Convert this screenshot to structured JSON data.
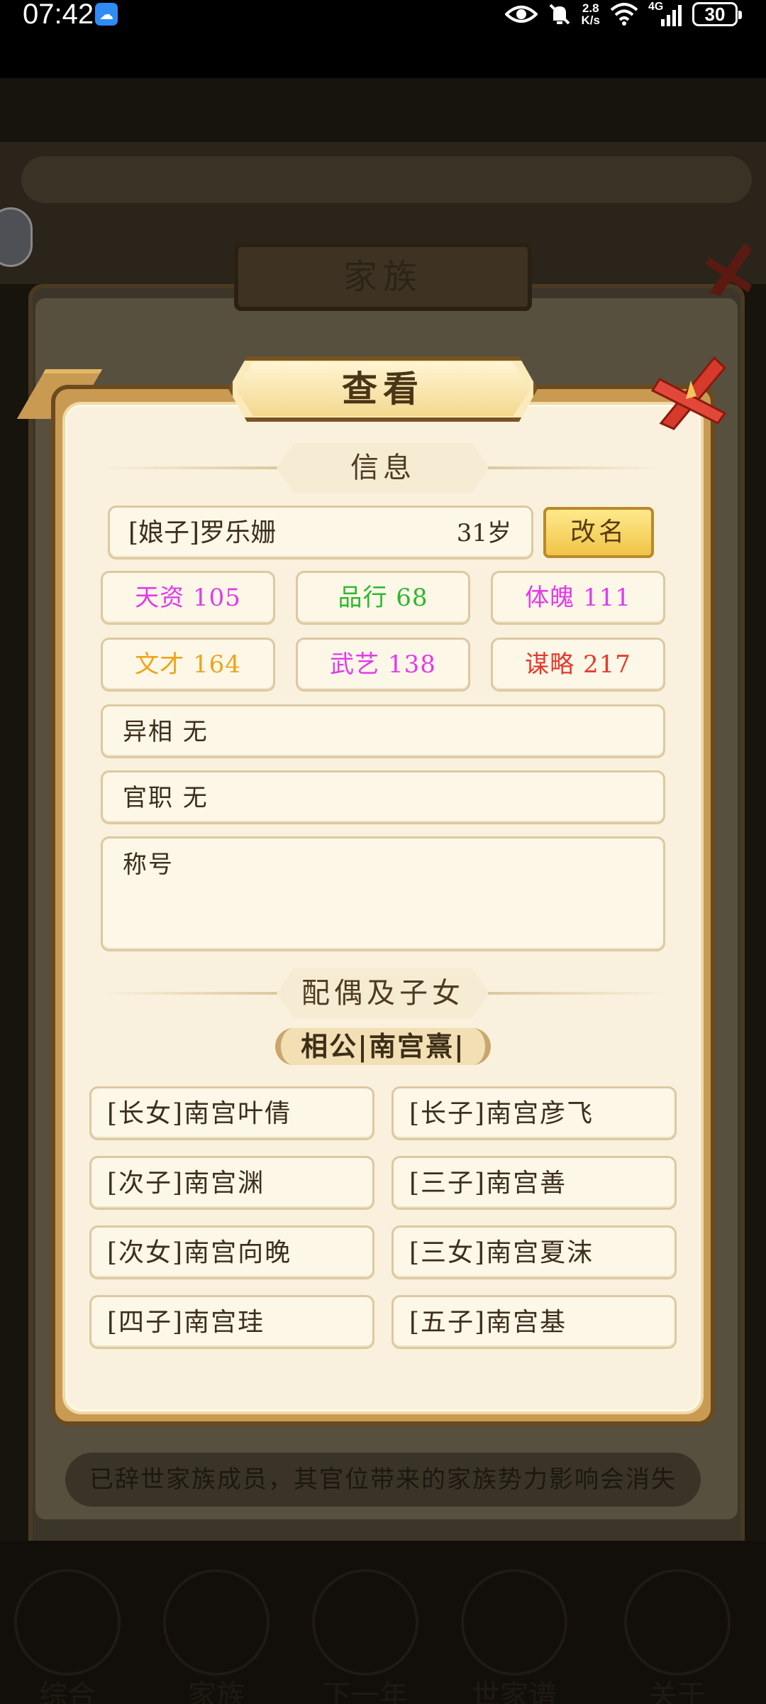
{
  "status_bar": {
    "time": "07:42",
    "net_speed_value": "2.8",
    "net_speed_unit": "K/s",
    "network_type": "4G",
    "battery": "30"
  },
  "background": {
    "panel_title": "家族",
    "footer_note": "已辞世家族成员，其官位带来的家族势力影响会消失",
    "bottom_nav": [
      "综合",
      "家族",
      "下一年",
      "世家谱",
      "关于"
    ]
  },
  "modal": {
    "title": "查看",
    "info_section_title": "信息",
    "member_name": "[娘子]罗乐姗",
    "member_age": "31岁",
    "rename_label": "改名",
    "stats": [
      {
        "label": "天资 105",
        "color": "#e23be8"
      },
      {
        "label": "品行 68",
        "color": "#2cb82c"
      },
      {
        "label": "体魄 111",
        "color": "#e23be8"
      },
      {
        "label": "文才 164",
        "color": "#f0a318"
      },
      {
        "label": "武艺 138",
        "color": "#e23be8"
      },
      {
        "label": "谋略 217",
        "color": "#e8382a"
      }
    ],
    "appearance": "异相  无",
    "official_post": "官职  无",
    "titles_label": "称号",
    "family_section_title": "配偶及子女",
    "spouse": "相公|南宫熹|",
    "children": [
      "[长女]南宫叶倩",
      "[长子]南宫彦飞",
      "[次子]南宫渊",
      "[三子]南宫善",
      "[次女]南宫向晚",
      "[三女]南宫夏沫",
      "[四子]南宫珪",
      "[五子]南宫基"
    ]
  }
}
